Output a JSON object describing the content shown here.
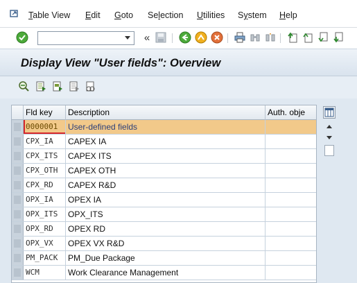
{
  "menubar": {
    "items": [
      {
        "pre": "",
        "ul": "T",
        "post": "able View"
      },
      {
        "pre": "",
        "ul": "E",
        "post": "dit"
      },
      {
        "pre": "",
        "ul": "G",
        "post": "oto"
      },
      {
        "pre": "Se",
        "ul": "l",
        "post": "ection"
      },
      {
        "pre": "",
        "ul": "U",
        "post": "tilities"
      },
      {
        "pre": "S",
        "ul": "y",
        "post": "stem"
      },
      {
        "pre": "",
        "ul": "H",
        "post": "elp"
      }
    ]
  },
  "toolbar": {
    "command_value": "",
    "back_chevron": "«"
  },
  "title": "Display View \"User fields\": Overview",
  "table": {
    "headers": {
      "key": "Fld key",
      "desc": "Description",
      "auth": "Auth. obje"
    },
    "rows": [
      {
        "key": "0000001",
        "desc": "User-defined fields",
        "auth": ""
      },
      {
        "key": "CPX_IA",
        "desc": "CAPEX IA",
        "auth": ""
      },
      {
        "key": "CPX_ITS",
        "desc": "CAPEX ITS",
        "auth": ""
      },
      {
        "key": "CPX_OTH",
        "desc": "CAPEX OTH",
        "auth": ""
      },
      {
        "key": "CPX_RD",
        "desc": "CAPEX R&D",
        "auth": ""
      },
      {
        "key": "OPX_IA",
        "desc": "OPEX IA",
        "auth": ""
      },
      {
        "key": "OPX_ITS",
        "desc": "OPX_ITS",
        "auth": ""
      },
      {
        "key": "OPX_RD",
        "desc": "OPEX RD",
        "auth": ""
      },
      {
        "key": "OPX_VX",
        "desc": "OPEX VX R&D",
        "auth": ""
      },
      {
        "key": "PM_PACK",
        "desc": "PM_Due Package",
        "auth": ""
      },
      {
        "key": "WCM",
        "desc": "Work Clearance Management",
        "auth": ""
      }
    ]
  },
  "colors": {
    "highlight_row": "#f2c98a",
    "title_gradient_top": "#eef3f8",
    "content_bg": "#dfe8f1"
  }
}
